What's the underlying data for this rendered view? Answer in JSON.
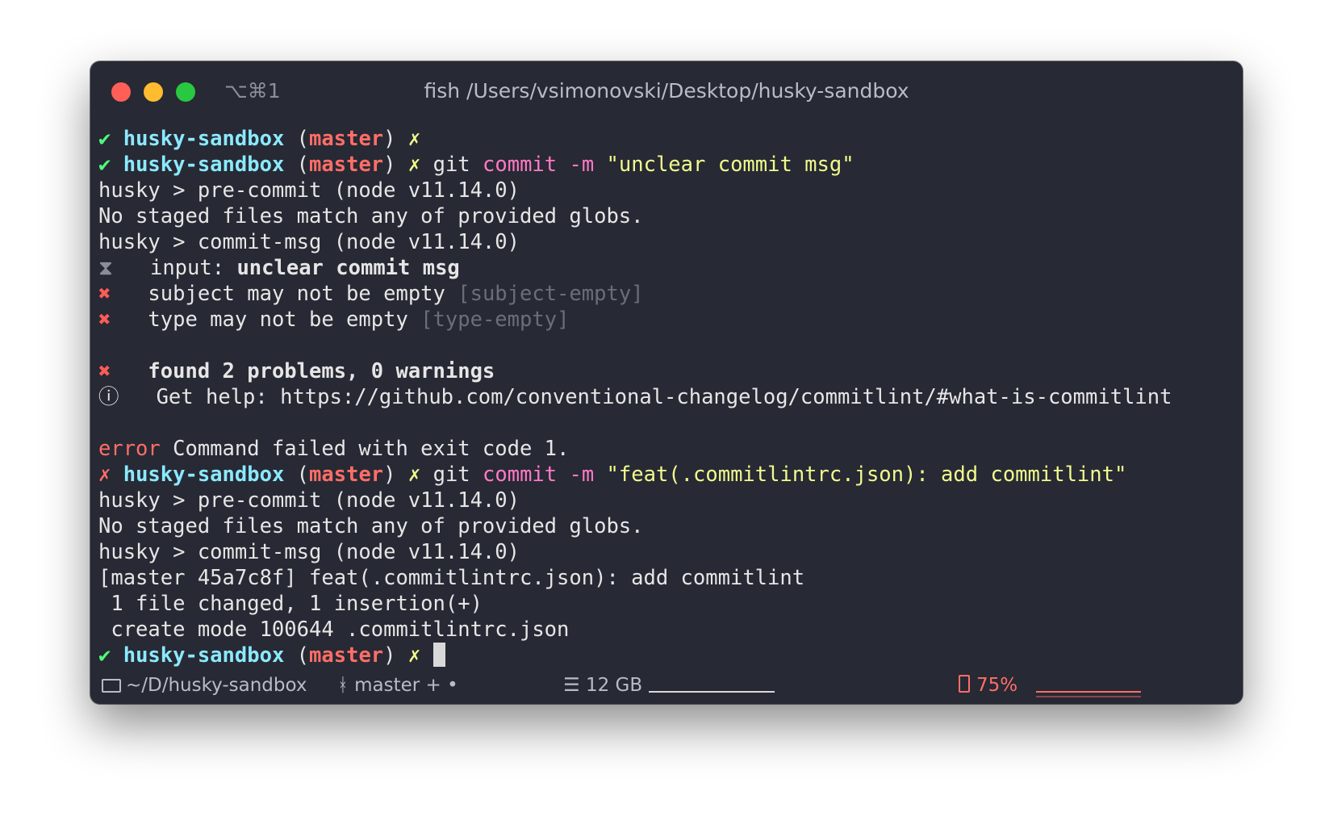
{
  "window": {
    "shortcut": "⌥⌘1",
    "title": "fish /Users/vsimonovski/Desktop/husky-sandbox"
  },
  "prompt": {
    "ok_mark": "✔",
    "fail_mark": "✗",
    "dir": "husky-sandbox",
    "branch": "master",
    "dirty_mark": "✗"
  },
  "commands": {
    "cmd1_git": "git",
    "cmd1_sub": "commit -m",
    "cmd1_msg": "\"unclear commit msg\"",
    "cmd2_git": "git",
    "cmd2_sub": "commit -m",
    "cmd2_msg": "\"feat(.commitlintrc.json): add commitlint\""
  },
  "output": {
    "precommit": "husky > pre-commit (node v11.14.0)",
    "no_staged": "No staged files match any of provided globs.",
    "commitmsg": "husky > commit-msg (node v11.14.0)",
    "input_icon": "⧗",
    "input_label": "input: ",
    "input_value": "unclear commit msg",
    "x_icon": "✖",
    "subject_err": "subject may not be empty ",
    "subject_tag": "[subject-empty]",
    "type_err": "type may not be empty ",
    "type_tag": "[type-empty]",
    "found": "found 2 problems, 0 warnings",
    "info_icon": "ⓘ",
    "help": "Get help: https://github.com/conventional-changelog/commitlint/#what-is-commitlint",
    "error_word": "error",
    "error_text": " Command failed with exit code 1.",
    "commit_result": "[master 45a7c8f] feat(.commitlintrc.json): add commitlint",
    "changed": " 1 file changed, 1 insertion(+)",
    "create_mode": " create mode 100644 .commitlintrc.json"
  },
  "statusbar": {
    "folder": "~/D/husky-sandbox",
    "branch": "master + •",
    "branch_icon": "ᚼ",
    "memory_icon": "☰",
    "memory": "12 GB",
    "battery": "75%",
    "battery_level": 0.75
  }
}
